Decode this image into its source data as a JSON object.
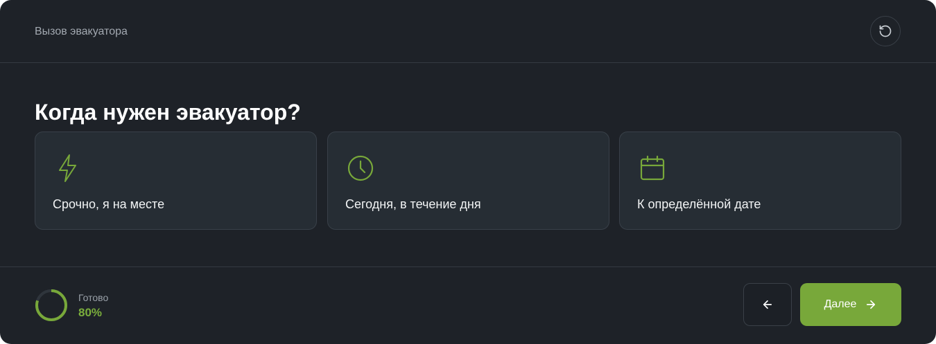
{
  "header": {
    "title": "Вызов эвакуатора",
    "reset_icon": "rotate-ccw-icon"
  },
  "question": {
    "title": "Когда нужен эвакуатор?"
  },
  "options": [
    {
      "label": "Срочно, я на месте",
      "icon": "lightning-icon"
    },
    {
      "label": "Сегодня, в течение дня",
      "icon": "clock-icon"
    },
    {
      "label": "К определённой дате",
      "icon": "calendar-icon"
    }
  ],
  "footer": {
    "progress_caption": "Готово",
    "progress_value": "80%",
    "progress_fraction": 0.8,
    "back_icon": "arrow-left-icon",
    "next_label": "Далее",
    "next_icon": "arrow-right-icon"
  },
  "colors": {
    "background": "#1e2228",
    "card": "#262d34",
    "accent": "#78a83a",
    "accent_text": "#7aae3c",
    "muted_text": "#a2a8b0"
  }
}
